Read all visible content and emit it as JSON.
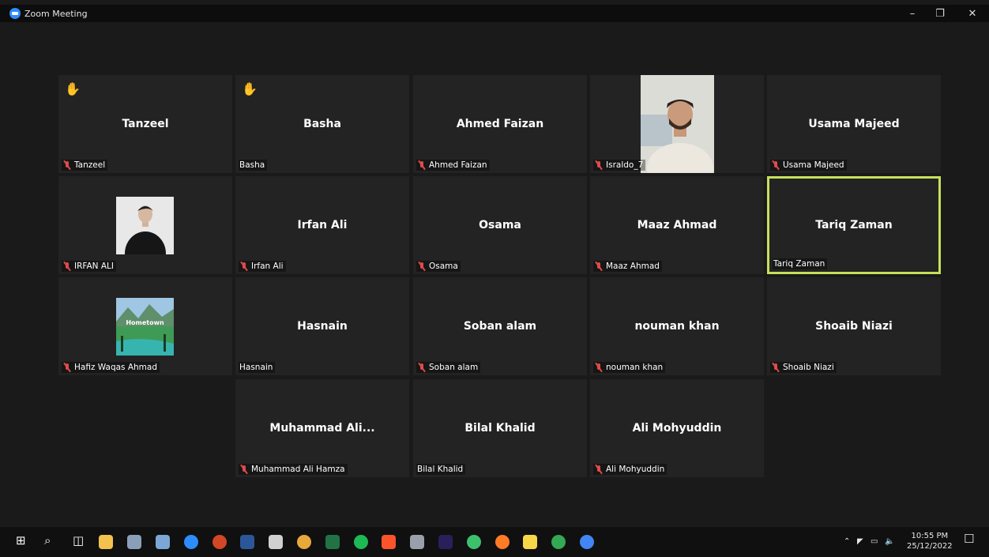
{
  "window": {
    "title": "Zoom Meeting"
  },
  "tiles": [
    {
      "display_name": "Tanzeel",
      "label": "Tanzeel",
      "muted": true,
      "hand_raised": true,
      "active": false
    },
    {
      "display_name": "Basha",
      "label": "Basha",
      "muted": false,
      "hand_raised": true,
      "active": false
    },
    {
      "display_name": "Ahmed Faizan",
      "label": "Ahmed Faizan",
      "muted": true,
      "hand_raised": false,
      "active": false
    },
    {
      "display_name": "",
      "label": "Israldo_7",
      "muted": true,
      "hand_raised": false,
      "active": false,
      "photo": "man-portrait"
    },
    {
      "display_name": "Usama Majeed",
      "label": "Usama Majeed",
      "muted": true,
      "hand_raised": false,
      "active": false
    },
    {
      "display_name": "",
      "label": "IRFAN ALI",
      "muted": true,
      "hand_raised": false,
      "active": false,
      "photo": "person-in-black"
    },
    {
      "display_name": "Irfan Ali",
      "label": "Irfan Ali",
      "muted": true,
      "hand_raised": false,
      "active": false
    },
    {
      "display_name": "Osama",
      "label": "Osama",
      "muted": true,
      "hand_raised": false,
      "active": false
    },
    {
      "display_name": "Maaz Ahmad",
      "label": "Maaz Ahmad",
      "muted": true,
      "hand_raised": false,
      "active": false
    },
    {
      "display_name": "Tariq Zaman",
      "label": "Tariq Zaman",
      "muted": false,
      "hand_raised": false,
      "active": true
    },
    {
      "display_name": "",
      "label": "Hafiz Waqas Ahmad",
      "muted": true,
      "hand_raised": false,
      "active": false,
      "photo": "landscape",
      "photo_text": "Hometown"
    },
    {
      "display_name": "Hasnain",
      "label": "Hasnain",
      "muted": false,
      "hand_raised": false,
      "active": false
    },
    {
      "display_name": "Soban alam",
      "label": "Soban alam",
      "muted": true,
      "hand_raised": false,
      "active": false
    },
    {
      "display_name": "nouman khan",
      "label": "nouman khan",
      "muted": true,
      "hand_raised": false,
      "active": false
    },
    {
      "display_name": "Shoaib Niazi",
      "label": "Shoaib Niazi",
      "muted": true,
      "hand_raised": false,
      "active": false
    },
    {
      "display_name": "Muhammad  Ali...",
      "label": "Muhammad Ali Hamza",
      "muted": true,
      "hand_raised": false,
      "active": false
    },
    {
      "display_name": "Bilal Khalid",
      "label": "Bilal Khalid",
      "muted": false,
      "hand_raised": false,
      "active": false
    },
    {
      "display_name": "Ali Mohyuddin",
      "label": "Ali Mohyuddin",
      "muted": true,
      "hand_raised": false,
      "active": false
    }
  ],
  "taskbar": {
    "icons": [
      "windows-start-icon",
      "search-icon",
      "task-view-icon",
      "file-explorer-icon",
      "photos-icon",
      "paint-icon",
      "zoom-icon",
      "powerpoint-icon",
      "word-icon",
      "calculator-icon",
      "chrome-icon",
      "excel-icon",
      "spotify-icon",
      "brave-icon",
      "app-icon",
      "premiere-icon",
      "vpn-icon",
      "firefox-icon",
      "sticky-notes-icon",
      "chrome-profile-icon",
      "chrome-profile-2-icon"
    ],
    "clock_time": "10:55 PM",
    "clock_date": "25/12/2022"
  },
  "colors": {
    "active_border": "#c5e15b",
    "mute": "#e04a4a",
    "hand": "#f4b731",
    "tile_bg": "#232323"
  }
}
